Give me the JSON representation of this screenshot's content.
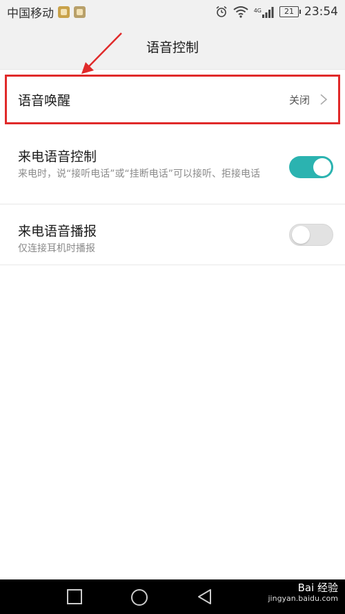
{
  "status_bar": {
    "carrier": "中国移动",
    "network": "4G",
    "battery": "21",
    "time": "23:54"
  },
  "header": {
    "title": "语音控制"
  },
  "settings": [
    {
      "title": "语音唤醒",
      "value": "关闭",
      "type": "link"
    },
    {
      "title": "来电语音控制",
      "subtitle": "来电时，说“接听电话”或“挂断电话”可以接听、拒接电话",
      "type": "toggle",
      "state": "on"
    },
    {
      "title": "来电语音播报",
      "subtitle": "仅连接耳机时播报",
      "type": "toggle",
      "state": "off"
    }
  ],
  "watermark": {
    "brand": "Bai 经验",
    "domain": "jingyan.baidu.com"
  },
  "colors": {
    "accent": "#2bb3b0",
    "highlight": "#e02a2a",
    "background": "#f1f1f1"
  },
  "icons": [
    "alarm-icon",
    "wifi-icon",
    "signal-icon",
    "battery-icon",
    "chevron-right-icon",
    "recent-apps-icon",
    "home-icon",
    "back-icon"
  ]
}
